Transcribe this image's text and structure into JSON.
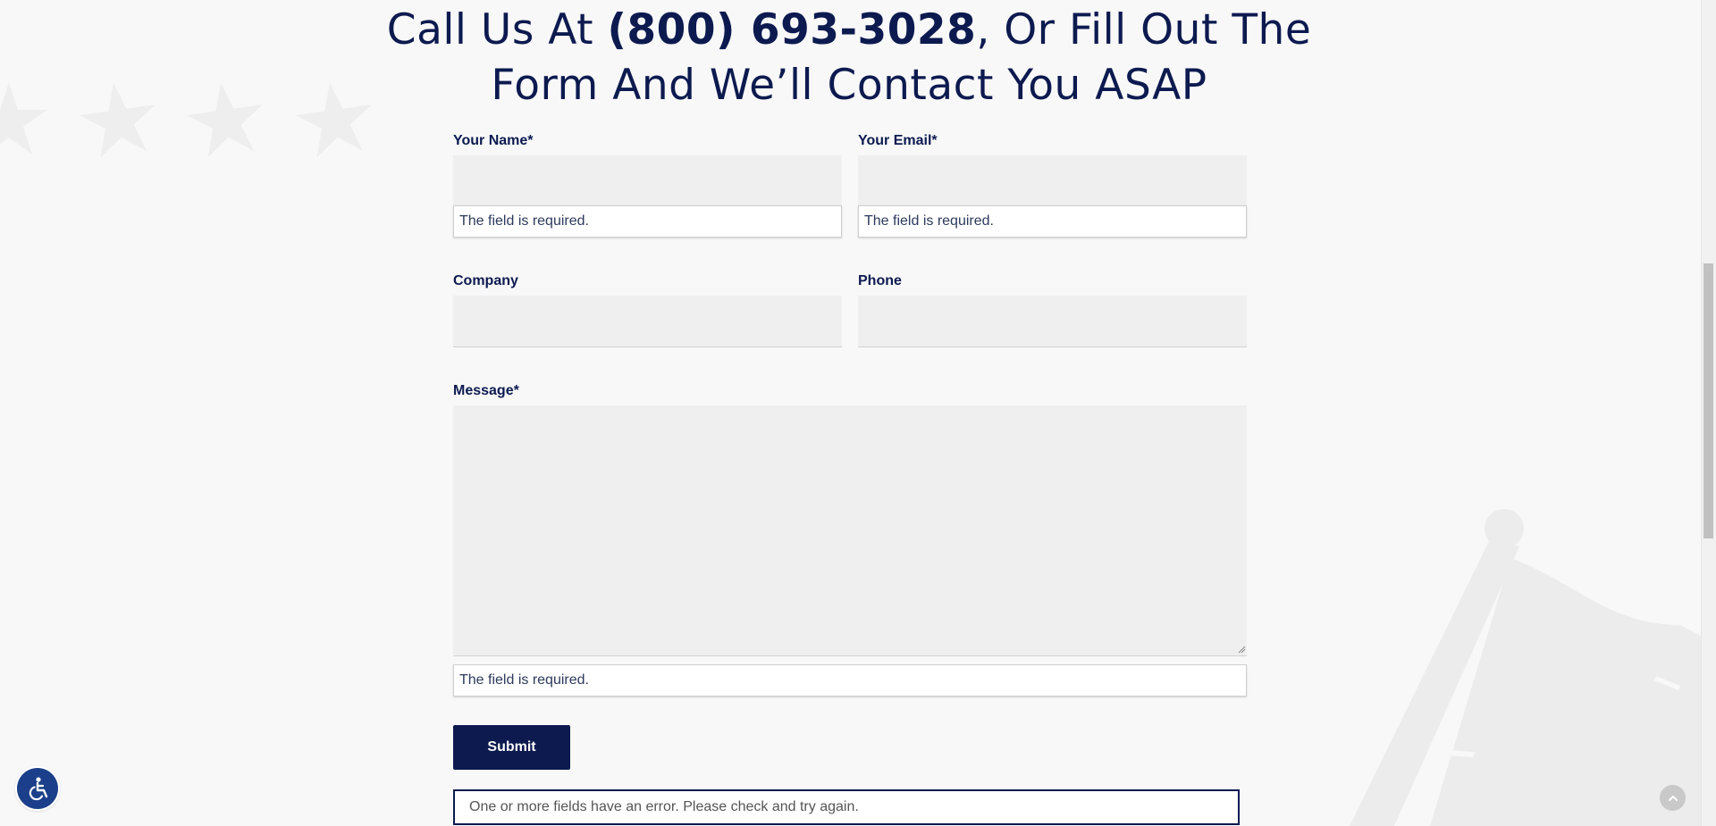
{
  "heading": {
    "prefix": "Call Us At ",
    "phone": "(800) 693-3028",
    "suffix_line1": ", Or Fill Out The",
    "line2": "Form And We’ll Contact You ASAP"
  },
  "form": {
    "name_label": "Your Name*",
    "name_value": "",
    "name_error": "The field is required.",
    "email_label": "Your Email*",
    "email_value": "",
    "email_error": "The field is required.",
    "company_label": "Company",
    "company_value": "",
    "phone_label": "Phone",
    "phone_value": "",
    "message_label": "Message*",
    "message_value": "",
    "message_error": "The field is required.",
    "submit_label": "Submit",
    "response_message": "One or more fields have an error. Please check and try again."
  },
  "icons": {
    "accessibility": "accessibility-icon",
    "scroll_top": "chevron-up-icon",
    "background_stars": "star-icon",
    "background_flag": "flag-icon"
  },
  "colors": {
    "brand_navy": "#0c1a4f",
    "field_bg": "#efefef",
    "page_bg": "#f8f8f9",
    "accessibility_blue": "#1b3f8a"
  }
}
